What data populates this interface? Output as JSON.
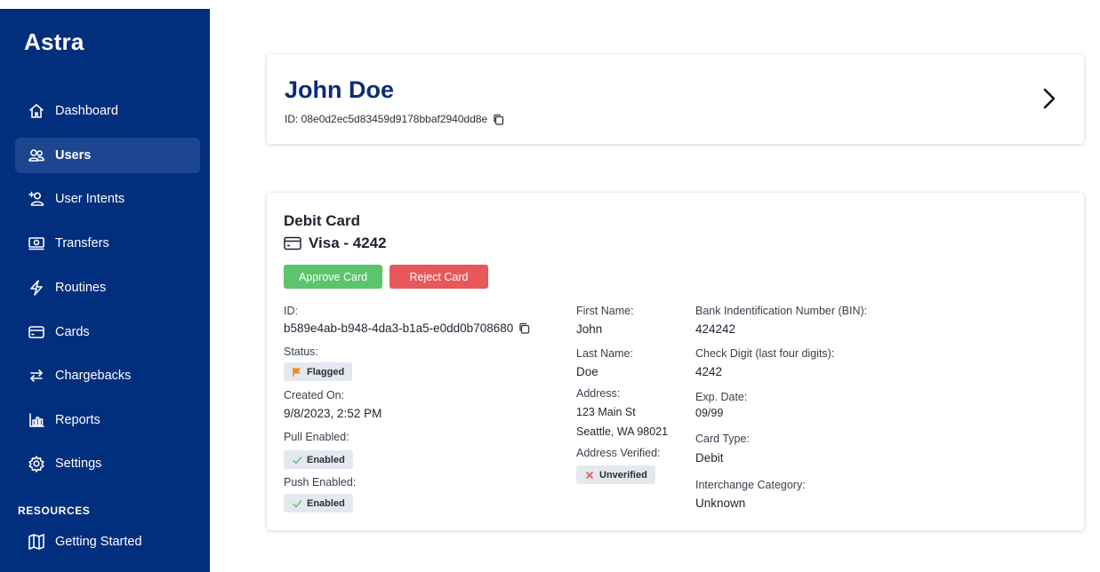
{
  "app": {
    "brand": "Astra"
  },
  "sidebar": {
    "items": [
      {
        "label": "Dashboard",
        "icon": "home-icon"
      },
      {
        "label": "Users",
        "icon": "users-icon",
        "active": true
      },
      {
        "label": "User Intents",
        "icon": "add-user-icon"
      },
      {
        "label": "Transfers",
        "icon": "money-icon"
      },
      {
        "label": "Routines",
        "icon": "lightning-icon"
      },
      {
        "label": "Cards",
        "icon": "credit-card-icon"
      },
      {
        "label": "Chargebacks",
        "icon": "arrows-exchange-icon"
      },
      {
        "label": "Reports",
        "icon": "bar-chart-icon"
      },
      {
        "label": "Settings",
        "icon": "gear-icon"
      }
    ],
    "resources_label": "RESOURCES",
    "resource_items": [
      {
        "label": "Getting Started",
        "icon": "map-icon"
      }
    ]
  },
  "user": {
    "name": "John Doe",
    "id_text": "ID: 08e0d2ec5d83459d9178bbaf2940dd8e"
  },
  "debit_card": {
    "title": "Debit Card",
    "subtitle": "Visa - 4242",
    "approve_label": "Approve Card",
    "reject_label": "Reject Card",
    "id_label": "ID:",
    "id_value": "b589e4ab-b948-4da3-b1a5-e0dd0b708680",
    "status_label": "Status:",
    "status_value": "Flagged",
    "created_label": "Created On:",
    "created_value": "9/8/2023, 2:52 PM",
    "pull_label": "Pull Enabled:",
    "pull_value": "Enabled",
    "push_label": "Push Enabled:",
    "push_value": "Enabled",
    "first_name_label": "First Name:",
    "first_name_value": "John",
    "last_name_label": "Last Name:",
    "last_name_value": "Doe",
    "address_label": "Address:",
    "address_line1": "123 Main St",
    "address_line2": "Seattle, WA 98021",
    "address_verified_label": "Address Verified:",
    "address_verified_value": "Unverified",
    "bin_label": "Bank Indentification Number (BIN):",
    "bin_value": "424242",
    "check_digit_label": "Check Digit (last four digits):",
    "check_digit_value": "4242",
    "exp_label": "Exp. Date:",
    "exp_value": "09/99",
    "card_type_label": "Card Type:",
    "card_type_value": "Debit",
    "interchange_label": "Interchange Category:",
    "interchange_value": "Unknown"
  },
  "colors": {
    "sidebar_bg": "#012E7D",
    "sidebar_active": "#1E4690",
    "heading": "#0C2C73",
    "approve": "#5CC46D",
    "reject": "#E8585A",
    "flag": "#F08A2B",
    "enabled_check": "#5CC46D",
    "unverified_x": "#E8585A"
  }
}
